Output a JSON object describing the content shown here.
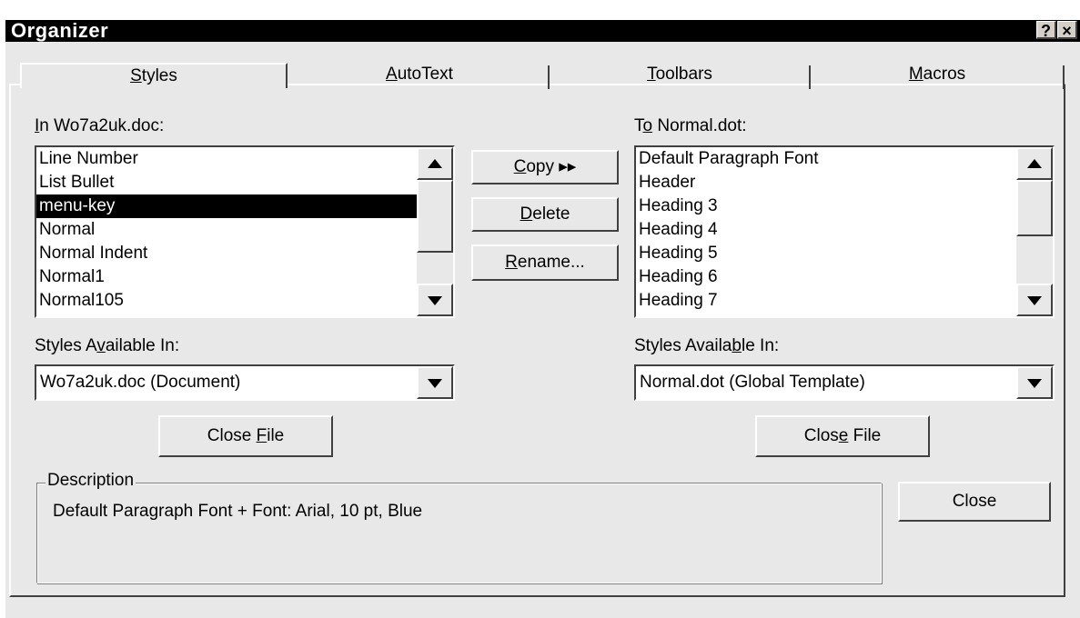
{
  "window": {
    "title": "Organizer",
    "help_label": "?",
    "close_label": "×"
  },
  "tabs": [
    {
      "pre": "",
      "key": "S",
      "post": "tyles"
    },
    {
      "pre": "",
      "key": "A",
      "post": "utoText"
    },
    {
      "pre": "",
      "key": "T",
      "post": "oolbars"
    },
    {
      "pre": "",
      "key": "M",
      "post": "acros"
    }
  ],
  "left": {
    "label_pre": "",
    "label_key": "I",
    "label_post": "n Wo7a2uk.doc:",
    "items": [
      "Line Number",
      "List Bullet",
      "menu-key",
      "Normal",
      "Normal Indent",
      "Normal1",
      "Normal105"
    ],
    "selected": "menu-key",
    "avail_pre": "Styles A",
    "avail_key": "v",
    "avail_post": "ailable In:",
    "avail_value": "Wo7a2uk.doc (Document)",
    "close_file_pre": "Close ",
    "close_file_key": "F",
    "close_file_post": "ile"
  },
  "right": {
    "label_pre": "T",
    "label_key": "o",
    "label_post": " Normal.dot:",
    "items": [
      "Default Paragraph Font",
      "Header",
      "Heading 3",
      "Heading 4",
      "Heading 5",
      "Heading 6",
      "Heading 7"
    ],
    "avail_pre": "Styles Availa",
    "avail_key": "b",
    "avail_post": "le In:",
    "avail_value": "Normal.dot (Global Template)",
    "close_file_pre": "Clos",
    "close_file_key": "e",
    "close_file_post": " File"
  },
  "middle": {
    "copy_key": "C",
    "copy_post": "opy ▸▸",
    "delete_key": "D",
    "delete_post": "elete",
    "rename_key": "R",
    "rename_post": "ename..."
  },
  "description": {
    "legend": "Description",
    "text": "Default Paragraph Font + Font: Arial, 10 pt, Blue"
  },
  "close_label": "Close"
}
